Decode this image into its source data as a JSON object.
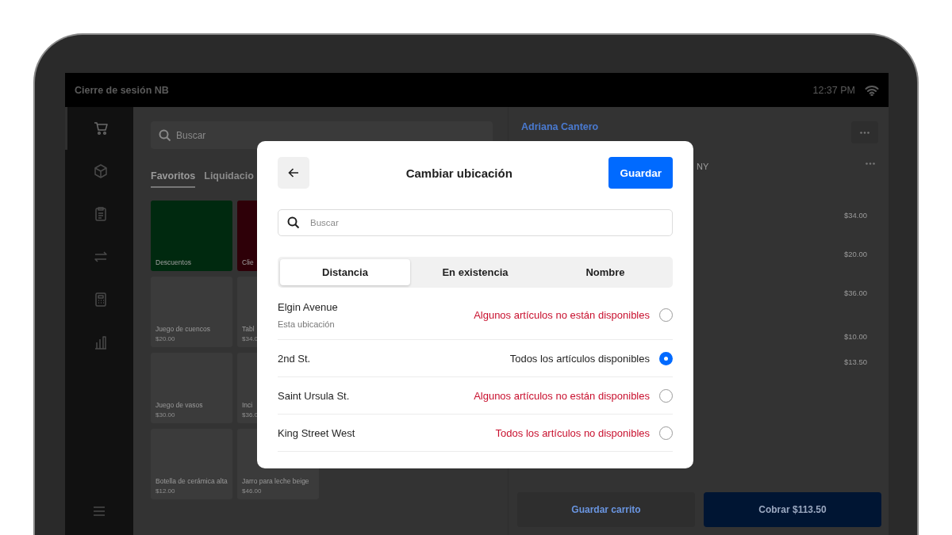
{
  "status_bar": {
    "title": "Cierre de sesión NB",
    "time": "12:37 PM"
  },
  "side_nav": {
    "items": [
      {
        "selected": true
      },
      {
        "selected": false
      },
      {
        "selected": false
      },
      {
        "selected": false
      },
      {
        "selected": false
      },
      {
        "selected": false
      }
    ]
  },
  "catalog": {
    "search": {
      "placeholder": "Buscar"
    },
    "tabs": [
      {
        "label": "Favoritos",
        "selected": true
      },
      {
        "label": "Liquidacio",
        "selected": false
      }
    ],
    "tiles": [
      {
        "kind": "category",
        "name": "Descuentos",
        "color": "#00290f"
      },
      {
        "kind": "category",
        "name": "Clie",
        "color": "#2e0008"
      },
      {
        "kind": "product",
        "name": "Juego de cuencos",
        "price": "$20.00"
      },
      {
        "kind": "product",
        "name": "Tabl",
        "price": "$34.0"
      },
      {
        "kind": "product",
        "name": "Juego de vasos",
        "price": "$30.00"
      },
      {
        "kind": "product",
        "name": "Inci",
        "price": "$36.0"
      },
      {
        "kind": "product",
        "name": "Botella de cerámica alta",
        "price": "$12.00"
      },
      {
        "kind": "product",
        "name": "Jarro para leche beige",
        "price": "$46.00"
      }
    ]
  },
  "cart": {
    "customer": "Adriana Cantero",
    "address_fragment": "NY",
    "prices": [
      "$34.00",
      "$20.00",
      "$36.00",
      "$10.00",
      "$13.50"
    ],
    "save_cart": "Guardar carrito",
    "charge": "Cobrar $113.50"
  },
  "modal": {
    "title": "Cambiar ubicación",
    "save": "Guardar",
    "search": {
      "placeholder": "Buscar"
    },
    "segments": [
      {
        "label": "Distancia",
        "selected": true
      },
      {
        "label": "En existencia",
        "selected": false
      },
      {
        "label": "Nombre",
        "selected": false
      }
    ],
    "locations": [
      {
        "name": "Elgin Avenue",
        "note": "Esta ubicación",
        "status": "Algunos artículos no están disponibles",
        "alert": true,
        "selected": false
      },
      {
        "name": "2nd St.",
        "status": "Todos los artículos disponibles",
        "alert": false,
        "selected": true
      },
      {
        "name": "Saint Ursula St.",
        "status": "Algunos artículos no están disponibles",
        "alert": true,
        "selected": false
      },
      {
        "name": "King Street West",
        "status": "Todos los artículos no disponibles",
        "alert": true,
        "selected": false
      }
    ]
  }
}
